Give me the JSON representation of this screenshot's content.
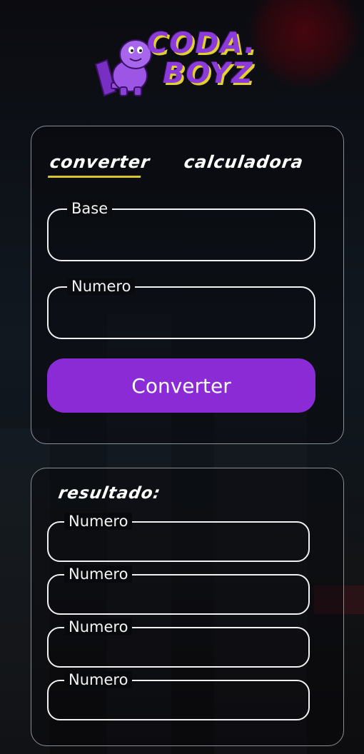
{
  "logo": {
    "line1": "coda.",
    "line2": "boyz",
    "colors": {
      "purple": "#8b3bdb",
      "yellow": "#e3d12b"
    }
  },
  "tabs": [
    {
      "label": "converter",
      "active": true
    },
    {
      "label": "calculadora",
      "active": false
    }
  ],
  "converter_form": {
    "base_label": "Base",
    "base_value": "",
    "numero_label": "Numero",
    "numero_value": "",
    "submit_label": "Converter"
  },
  "result": {
    "title": "resultado:",
    "fields": [
      {
        "label": "Numero",
        "value": ""
      },
      {
        "label": "Numero",
        "value": ""
      },
      {
        "label": "Numero",
        "value": ""
      },
      {
        "label": "Numero",
        "value": ""
      }
    ]
  },
  "colors": {
    "accent": "#8a2bd6",
    "tab_underline": "#d8c62a",
    "border": "#f2f2f2"
  }
}
